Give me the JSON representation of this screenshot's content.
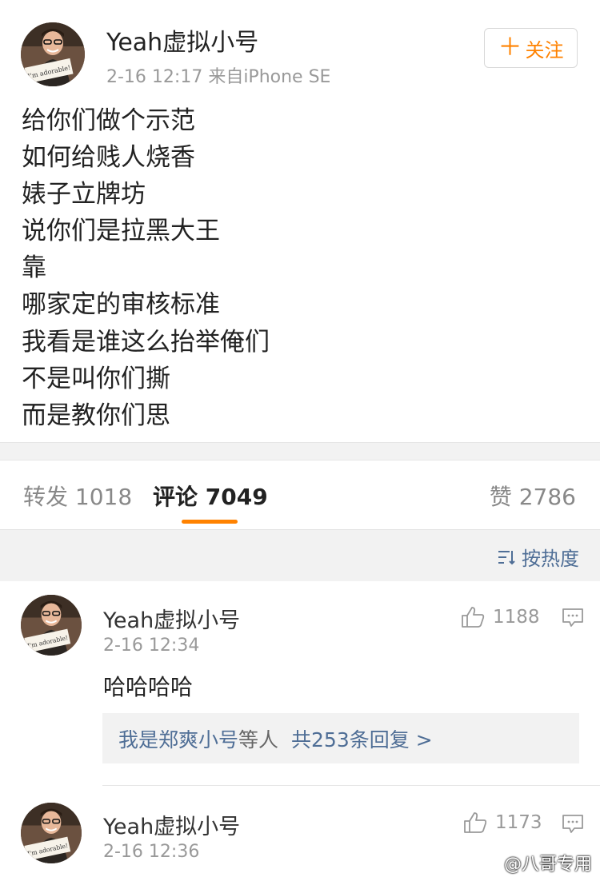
{
  "post": {
    "username": "Yeah虚拟小号",
    "meta": "2-16 12:17  来自iPhone SE",
    "follow_label": "关注",
    "lines": [
      "给你们做个示范",
      "如何给贱人烧香",
      "婊子立牌坊",
      "说你们是拉黑大王",
      "靠",
      "哪家定的审核标准",
      "我看是谁这么抬举俺们",
      "不是叫你们撕",
      "而是教你们思"
    ]
  },
  "tabs": {
    "forward": "转发 1018",
    "comments": "评论 7049",
    "likes": "赞 2786"
  },
  "sort": {
    "label": "按热度"
  },
  "comments": [
    {
      "username": "Yeah虚拟小号",
      "time": "2-16 12:34",
      "text": "哈哈哈哈",
      "likes": "1188",
      "reply_users": "我是郑爽小号",
      "reply_mid": "等人",
      "reply_count": "共253条回复 >"
    },
    {
      "username": "Yeah虚拟小号",
      "time": "2-16 12:36",
      "likes": "1173"
    }
  ],
  "avatar_caption": "I'm adorable!",
  "watermark": "@八哥专用",
  "colors": {
    "accent": "#ff8200",
    "link": "#4f6e96",
    "band": "#f2f2f2"
  }
}
